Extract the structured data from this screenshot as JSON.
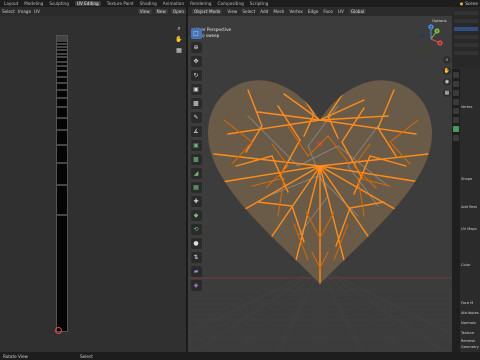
{
  "topbar": {
    "workspaces": [
      "Layout",
      "Modeling",
      "Sculpting",
      "UV Editing",
      "Texture Paint",
      "Shading",
      "Animation",
      "Rendering",
      "Compositing",
      "Scripting"
    ],
    "scene_label": "Scene"
  },
  "uv_editor": {
    "header_items": [
      "Select",
      "Image",
      "UV"
    ],
    "view_label": "View",
    "new_label": "New",
    "open_label": "Open"
  },
  "viewport3d": {
    "header_items": [
      "Object Mode",
      "View",
      "Select",
      "Add",
      "Mesh",
      "Vertex",
      "Edge",
      "Face",
      "UV"
    ],
    "transform_label": "Global",
    "info_line1": "User Perspective",
    "info_line2": "(85) sweep",
    "options_label": "Options",
    "gizmo_axes": [
      "X",
      "Y",
      "Z"
    ]
  },
  "properties": {
    "rows": [
      "Vertex",
      "Shape",
      "Add Rest",
      "UV Maps",
      "Color",
      "Face M",
      "Attributes",
      "Normals",
      "Texture",
      "Remesh",
      "Geometry",
      "Custom"
    ]
  },
  "statusbar": {
    "left": "Rotate View",
    "middle": "Select"
  },
  "colors": {
    "hair": "#ff8c1a",
    "hair_dark": "#d96a00",
    "accent": "#4772b3"
  }
}
